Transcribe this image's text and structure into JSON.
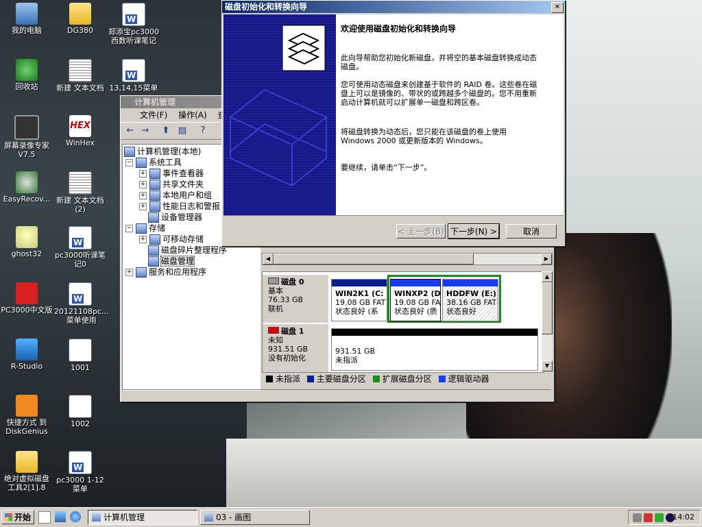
{
  "desktop": {
    "icons": [
      {
        "label": "我的电脑"
      },
      {
        "label": "DG380"
      },
      {
        "label": "郑添宝pc3000西数听课笔记"
      },
      {
        "label": "回收站"
      },
      {
        "label": "新建 文本文档"
      },
      {
        "label": "13,14,15菜单"
      },
      {
        "label": "屏幕录像专家V7.5"
      },
      {
        "label": "WinHex"
      },
      {
        "label": "EasyRecov..."
      },
      {
        "label": "新建 文本文档 (2)"
      },
      {
        "label": "ghost32"
      },
      {
        "label": "pc3000听课笔记0"
      },
      {
        "label": "PC3000中文版"
      },
      {
        "label": "20121108pc...菜单使用"
      },
      {
        "label": "R-Studio"
      },
      {
        "label": "1001"
      },
      {
        "label": "快捷方式 到 DiskGenius"
      },
      {
        "label": "1002"
      },
      {
        "label": "绝对虚拟磁盘工具2[1].8"
      },
      {
        "label": "pc3000 1-12菜单"
      }
    ],
    "hex_icon_text": "HEX"
  },
  "comp_mgmt": {
    "title": "计算机管理",
    "menu": [
      "文件(F)",
      "操作(A)",
      "查"
    ],
    "tree": [
      {
        "label": "计算机管理(本地)"
      },
      {
        "label": "系统工具"
      },
      {
        "label": "事件查看器"
      },
      {
        "label": "共享文件夹"
      },
      {
        "label": "本地用户和组"
      },
      {
        "label": "性能日志和警报"
      },
      {
        "label": "设备管理器"
      },
      {
        "label": "存储"
      },
      {
        "label": "可移动存储"
      },
      {
        "label": "磁盘碎片整理程序"
      },
      {
        "label": "磁盘管理"
      },
      {
        "label": "服务和应用程序"
      }
    ],
    "disks": [
      {
        "name": "磁盘 0",
        "type": "基本",
        "size": "76.33 GB",
        "status": "联机",
        "partitions": [
          {
            "name": "WIN2K1 (C:",
            "size": "19.08 GB FAT",
            "status": "状态良好 (系"
          },
          {
            "name": "WINXP2 (D",
            "size": "19.08 GB FA",
            "status": "状态良好 (质"
          },
          {
            "name": "HDDFW (E:)",
            "size": "38.16 GB FAT",
            "status": "状态良好"
          }
        ]
      },
      {
        "name": "磁盘 1",
        "type": "未知",
        "size": "931.51 GB",
        "status": "没有初始化",
        "partitions": [
          {
            "name": "",
            "size": "931.51 GB",
            "status": "未指派"
          }
        ]
      }
    ],
    "legend": [
      {
        "label": "未指派",
        "color": "#000000"
      },
      {
        "label": "主要磁盘分区",
        "color": "#0a1f8f"
      },
      {
        "label": "扩展磁盘分区",
        "color": "#1b8a1b"
      },
      {
        "label": "逻辑驱动器",
        "color": "#1a3cf0"
      }
    ]
  },
  "wizard": {
    "title": "磁盘初始化和转换向导",
    "heading": "欢迎使用磁盘初始化和转换向导",
    "para1": "此向导帮助您初始化新磁盘，并将空的基本磁盘转换成动态磁盘。",
    "para2": "您可使用动态磁盘来创建基于软件的 RAID 卷。这些卷在磁盘上可以是镜像的、带状的或跨越多个磁盘的。您不用重新启动计算机就可以扩展单一磁盘和跨区卷。",
    "para3": "将磁盘转换为动态后，您只能在该磁盘的卷上使用 Windows 2000 或更新版本的 Windows。",
    "para4": "要继续，请单击“下一步”。",
    "btn_back": "< 上一步(B)",
    "btn_next": "下一步(N) >",
    "btn_cancel": "取消"
  },
  "taskbar": {
    "start": "开始",
    "tasks": [
      "计算机管理",
      "03 - 画图"
    ],
    "clock": "14:02"
  }
}
